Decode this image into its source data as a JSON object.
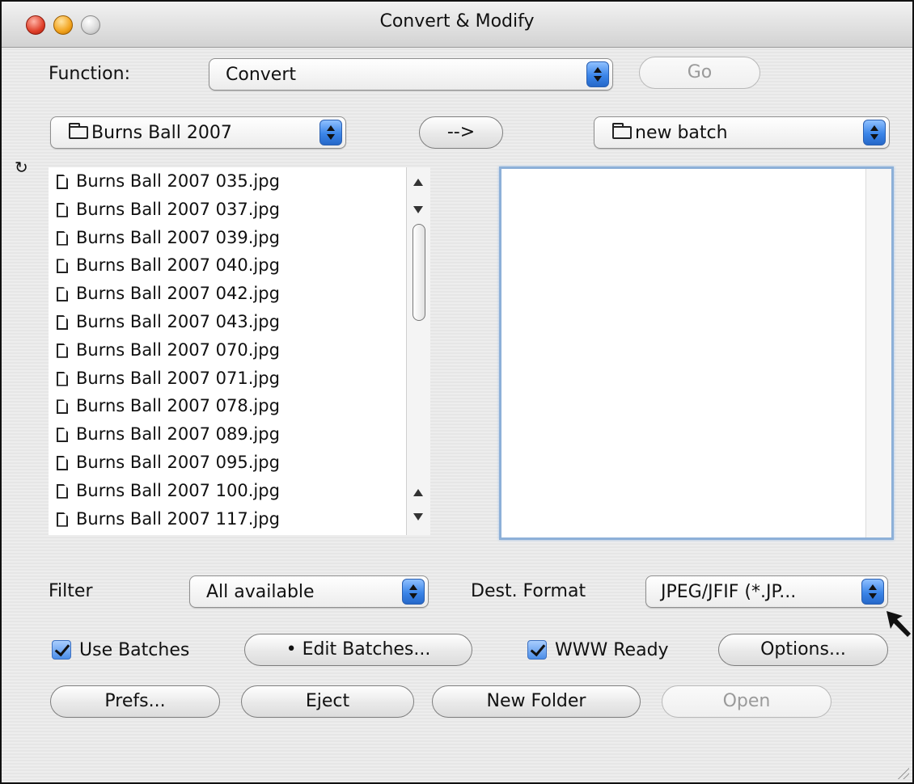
{
  "window": {
    "title": "Convert & Modify"
  },
  "function_row": {
    "label": "Function:",
    "selected": "Convert",
    "go_label": "Go"
  },
  "batch_row": {
    "source_folder": "Burns Ball 2007",
    "transfer_label": "-->",
    "dest_folder": "new batch"
  },
  "source_files": [
    "Burns Ball 2007 035.jpg",
    "Burns Ball 2007 037.jpg",
    "Burns Ball 2007 039.jpg",
    "Burns Ball 2007 040.jpg",
    "Burns Ball 2007 042.jpg",
    "Burns Ball 2007 043.jpg",
    "Burns Ball 2007 070.jpg",
    "Burns Ball 2007 071.jpg",
    "Burns Ball 2007 078.jpg",
    "Burns Ball 2007 089.jpg",
    "Burns Ball 2007 095.jpg",
    "Burns Ball 2007 100.jpg",
    "Burns Ball 2007 117.jpg"
  ],
  "filter_row": {
    "filter_label": "Filter",
    "filter_value": "All available",
    "dest_format_label": "Dest. Format",
    "dest_format_value": "JPEG/JFIF (*.JP..."
  },
  "options_row": {
    "use_batches_label": "Use Batches",
    "use_batches_checked": true,
    "edit_batches_label": "• Edit Batches...",
    "www_ready_label": "WWW Ready",
    "www_ready_checked": true,
    "options_label": "Options..."
  },
  "bottom_buttons": {
    "prefs": "Prefs...",
    "eject": "Eject",
    "new_folder": "New Folder",
    "open": "Open"
  },
  "icons": {
    "accent": "#3b85e8",
    "focus_ring": "#8db0d8"
  }
}
